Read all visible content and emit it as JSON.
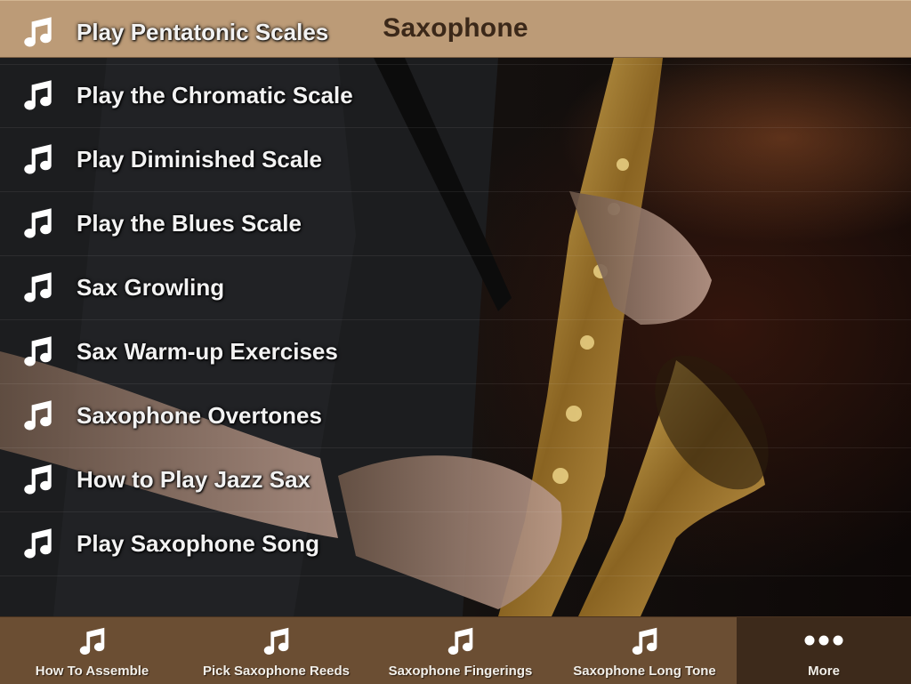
{
  "header": {
    "title": "Saxophone"
  },
  "list": {
    "items": [
      {
        "label": "Play Pentatonic Scales",
        "icon": "music-note-icon"
      },
      {
        "label": "Play the Chromatic Scale",
        "icon": "music-note-icon"
      },
      {
        "label": "Play Diminished Scale",
        "icon": "music-note-icon"
      },
      {
        "label": "Play the Blues Scale",
        "icon": "music-note-icon"
      },
      {
        "label": "Sax Growling",
        "icon": "music-note-icon"
      },
      {
        "label": "Sax Warm-up Exercises",
        "icon": "music-note-icon"
      },
      {
        "label": "Saxophone Overtones",
        "icon": "music-note-icon"
      },
      {
        "label": "How to Play Jazz Sax",
        "icon": "music-note-icon"
      },
      {
        "label": "Play Saxophone Song",
        "icon": "music-note-icon"
      }
    ]
  },
  "tabbar": {
    "tabs": [
      {
        "label": "How To Assemble",
        "icon": "music-note-icon"
      },
      {
        "label": "Pick Saxophone Reeds",
        "icon": "music-note-icon"
      },
      {
        "label": "Saxophone Fingerings",
        "icon": "music-note-icon"
      },
      {
        "label": "Saxophone Long Tone",
        "icon": "music-note-icon"
      },
      {
        "label": "More",
        "icon": "more-dots-icon"
      }
    ]
  },
  "colors": {
    "header_bg": "#bc9b77",
    "header_text": "#3b2819",
    "tabbar_bg": "#6b4e33",
    "tabbar_active_bg": "#3d2a1b",
    "list_text": "#f2f2f2"
  }
}
